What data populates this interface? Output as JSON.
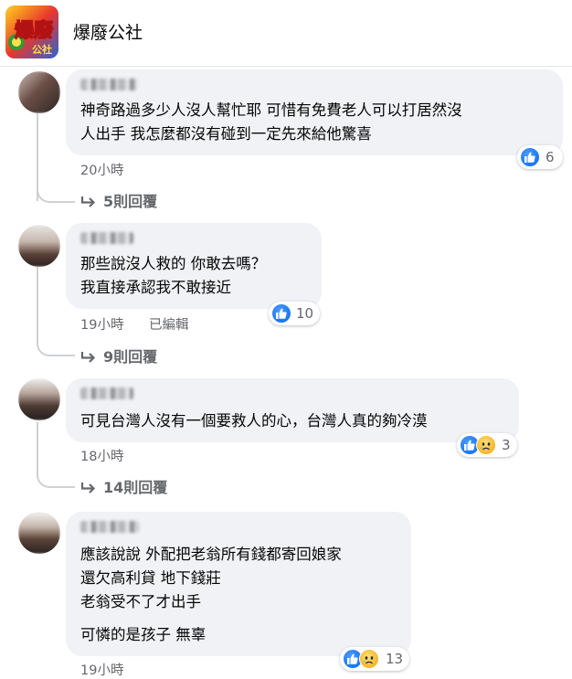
{
  "header": {
    "page_name": "爆廢公社",
    "logo_text": "爆廢公社"
  },
  "colors": {
    "bubble": "#f0f2f5",
    "meta_text": "#65676b",
    "like_blue": "#1877f2",
    "sad_yellow": "#f7b125"
  },
  "comments": [
    {
      "lines": [
        "神奇路過多少人沒人幫忙耶 可惜有免費老人可以打居然沒",
        "人出手 我怎麼都沒有碰到一定先來給他驚喜"
      ],
      "reactions": [
        "like-icon"
      ],
      "reaction_count": "6",
      "time": "20小時",
      "edited": "",
      "replies_label": "5則回覆"
    },
    {
      "lines": [
        "那些說沒人救的 你敢去嗎？",
        "我直接承認我不敢接近"
      ],
      "reactions": [
        "like-icon"
      ],
      "reaction_count": "10",
      "time": "19小時",
      "edited": "已編輯",
      "replies_label": "9則回覆"
    },
    {
      "lines": [
        "可見台灣人沒有一個要救人的心，台灣人真的夠冷漠"
      ],
      "reactions": [
        "like-icon",
        "sad-icon"
      ],
      "reaction_count": "3",
      "time": "18小時",
      "edited": "",
      "replies_label": "14則回覆"
    },
    {
      "lines": [
        "應該說說 外配把老翁所有錢都寄回娘家",
        "還欠高利貸 地下錢莊",
        "老翁受不了才出手",
        "可憐的是孩子 無辜"
      ],
      "reactions": [
        "like-icon",
        "sad-icon"
      ],
      "reaction_count": "13",
      "time": "19小時",
      "edited": "",
      "replies_label": ""
    }
  ]
}
